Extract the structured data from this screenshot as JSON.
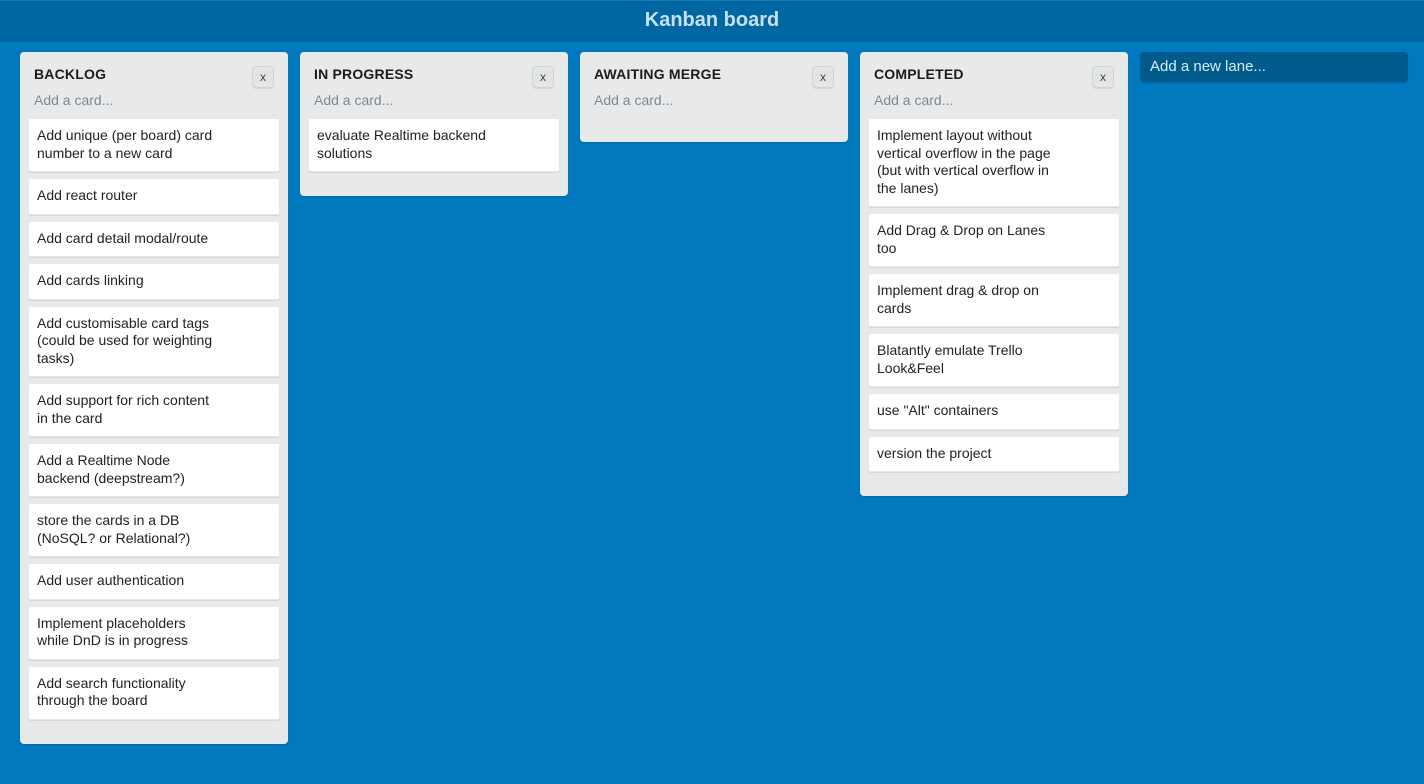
{
  "header": {
    "title": "Kanban board"
  },
  "add_lane_label": "Add a new lane...",
  "add_card_label": "Add a card...",
  "lane_close_label": "x",
  "lanes": [
    {
      "title": "BACKLOG",
      "cards": [
        "Add unique (per board) card number to a new card",
        "Add react router",
        "Add card detail modal/route",
        "Add cards linking",
        "Add customisable card tags (could be used for weighting tasks)",
        "Add support for rich content in the card",
        "Add a Realtime Node backend (deepstream?)",
        "store the cards in a DB (NoSQL? or Relational?)",
        "Add user authentication",
        "Implement placeholders while DnD is in progress",
        "Add search functionality through the board"
      ]
    },
    {
      "title": "IN PROGRESS",
      "cards": [
        "evaluate Realtime backend solutions"
      ]
    },
    {
      "title": "AWAITING MERGE",
      "cards": []
    },
    {
      "title": "COMPLETED",
      "cards": [
        "Implement layout without vertical overflow in the page (but with vertical overflow in the lanes)",
        "Add Drag & Drop on Lanes too",
        "Implement drag & drop on cards",
        "Blatantly emulate Trello Look&Feel",
        "use \"Alt\" containers",
        "version the project"
      ]
    }
  ]
}
